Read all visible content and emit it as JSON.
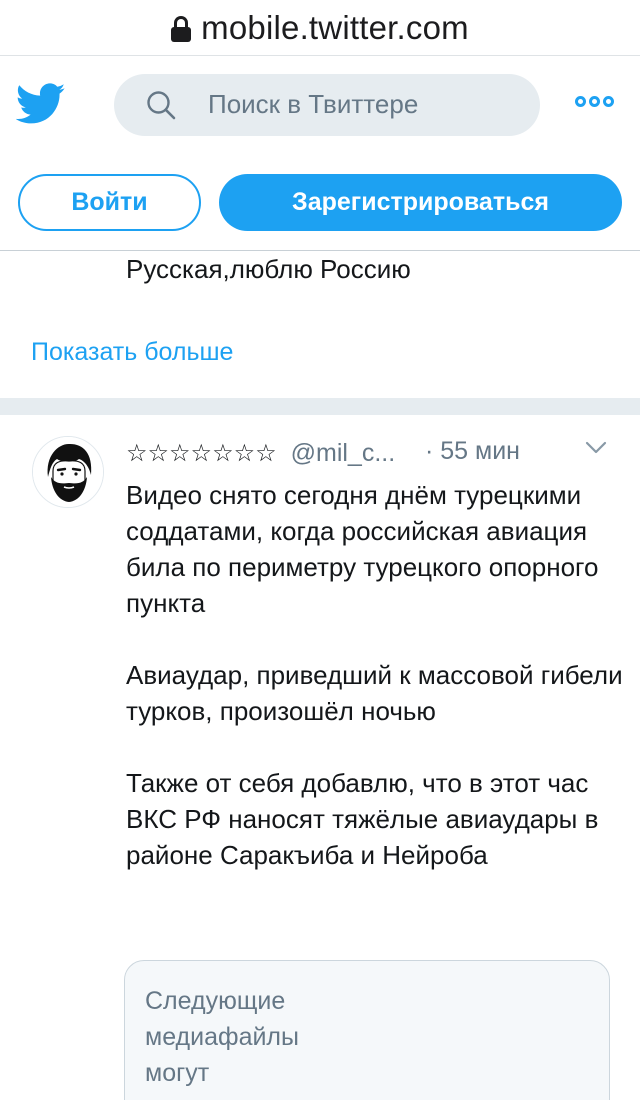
{
  "browser": {
    "url": "mobile.twitter.com"
  },
  "header": {
    "search_placeholder": "Поиск в Твиттере",
    "login_label": "Войти",
    "signup_label": "Зарегистрироваться"
  },
  "profile": {
    "bio_line": "Русская,люблю Россию",
    "show_more": "Показать больше"
  },
  "tweet": {
    "display_name": "☆☆☆☆☆☆☆",
    "handle": "@mil_c...",
    "time": "· 55 мин",
    "paragraphs": [
      "Видео снято сегодня днём турецкими соддатами, когда российская авиация била по периметру турецкого опорного пункта",
      "Авиаудар, приведший к массовой гибели турков, произошёл ночью",
      "Также от себя добавлю, что в этот час ВКС РФ наносят тяжёлые авиаудары в районе Саракъиба и Нейроба"
    ],
    "media_warning": "Следующие медиафайлы могут"
  },
  "colors": {
    "accent": "#1da1f2",
    "search_bg": "#e6ecf0",
    "muted_text": "#657786"
  },
  "icons": [
    "lock-icon",
    "twitter-bird-icon",
    "search-icon",
    "more-icon",
    "chevron-down-icon",
    "avatar"
  ]
}
